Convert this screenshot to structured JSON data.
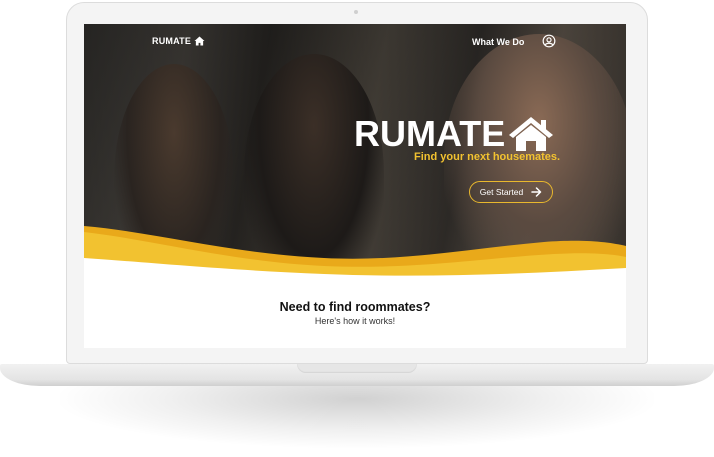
{
  "nav": {
    "brand": "RUMATE",
    "brand_icon": "house-icon",
    "links": [
      "What We Do"
    ],
    "account_icon": "user-circle-icon"
  },
  "hero": {
    "logo_text": "RUMATE",
    "logo_icon": "house-icon",
    "tagline": "Find your next housemates.",
    "cta_label": "Get Started",
    "cta_icon": "arrow-right-icon"
  },
  "section": {
    "title": "Need to find roommates?",
    "subtitle": "Here's how it works!"
  },
  "colors": {
    "accent": "#f2c230",
    "accent_dark": "#e9a91a",
    "text_dark": "#111111"
  }
}
